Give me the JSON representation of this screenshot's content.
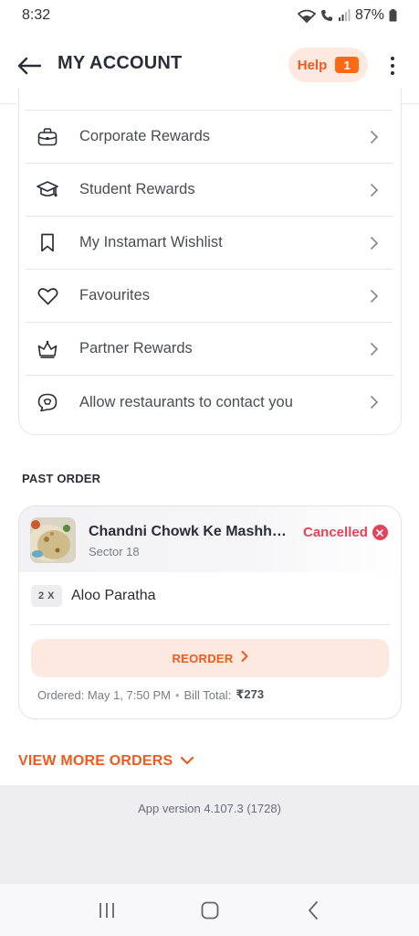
{
  "status_bar": {
    "time": "8:32",
    "battery": "87%"
  },
  "header": {
    "title": "MY ACCOUNT",
    "help_label": "Help",
    "help_count": "1"
  },
  "menu": {
    "items": [
      {
        "label": "Corporate Rewards",
        "icon": "briefcase-icon"
      },
      {
        "label": "Student Rewards",
        "icon": "graduation-cap-icon"
      },
      {
        "label": "My Instamart Wishlist",
        "icon": "bookmark-icon"
      },
      {
        "label": "Favourites",
        "icon": "heart-icon"
      },
      {
        "label": "Partner Rewards",
        "icon": "crown-icon"
      },
      {
        "label": "Allow restaurants to contact you",
        "icon": "chat-bubble-icon"
      }
    ]
  },
  "past_order": {
    "section_title": "PAST ORDER",
    "restaurant": "Chandni Chowk Ke Mashhur Paranthe",
    "area": "Sector 18",
    "status": "Cancelled",
    "items": [
      {
        "qty": "2 X",
        "name": "Aloo Paratha"
      }
    ],
    "reorder_label": "REORDER",
    "ordered_label": "Ordered: May 1, 7:50 PM",
    "bill_label": "Bill Total:",
    "bill_total": "₹273"
  },
  "view_more_label": "VIEW MORE ORDERS",
  "app_version": "App version 4.107.3 (1728)",
  "colors": {
    "accent": "#f05a1e",
    "cancelled": "#e4435a",
    "help_bg": "#fde9df"
  }
}
